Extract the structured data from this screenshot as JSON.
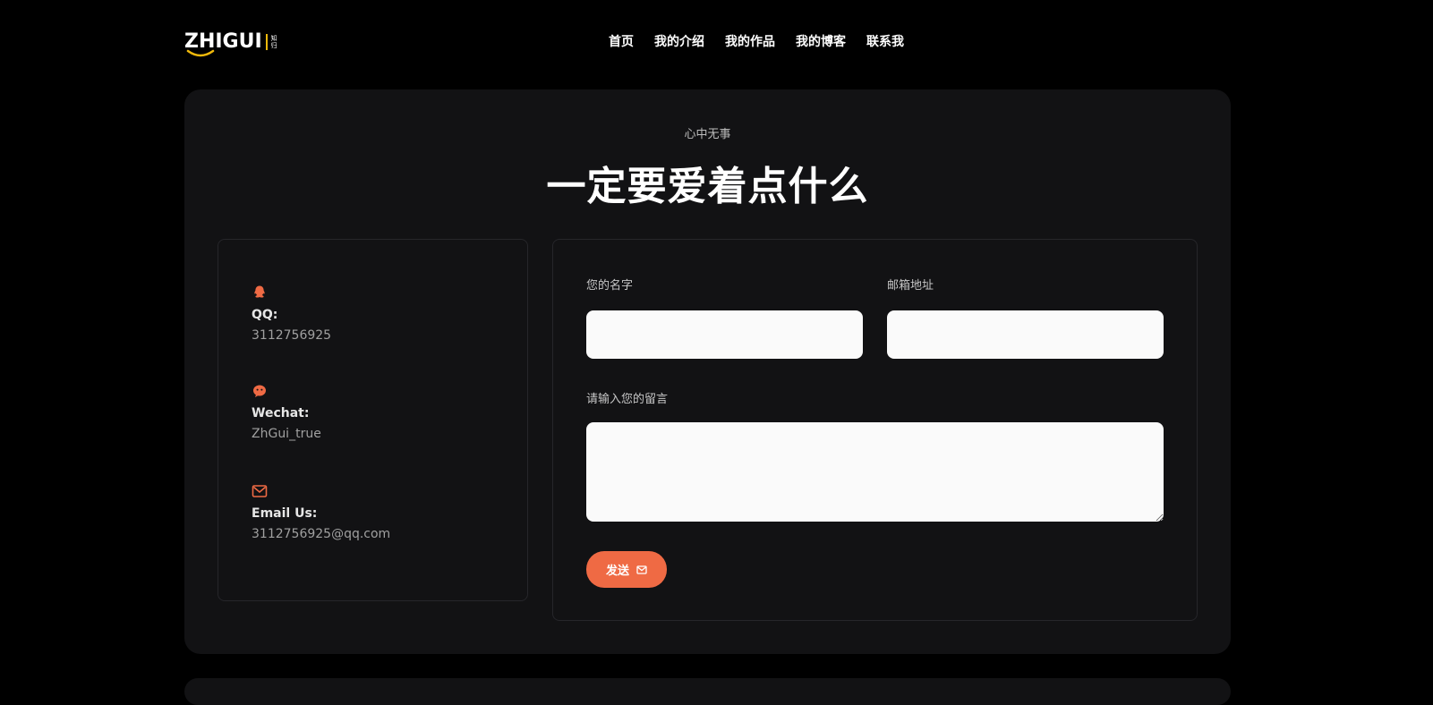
{
  "header": {
    "logo_text": "ZHIGUI",
    "logo_sub": "知归",
    "nav": [
      "首页",
      "我的介绍",
      "我的作品",
      "我的博客",
      "联系我"
    ]
  },
  "hero": {
    "kicker": "心中无事",
    "title": "一定要爱着点什么"
  },
  "contact": {
    "items": [
      {
        "icon": "qq-icon",
        "label": "QQ:",
        "value": "3112756925"
      },
      {
        "icon": "wechat-icon",
        "label": "Wechat:",
        "value": "ZhGui_true"
      },
      {
        "icon": "mail-icon",
        "label": "Email Us:",
        "value": "3112756925@qq.com"
      }
    ]
  },
  "form": {
    "name_label": "您的名字",
    "email_label": "邮箱地址",
    "message_label": "请输入您的留言",
    "name_value": "",
    "email_value": "",
    "message_value": "",
    "send_label": "发送"
  },
  "colors": {
    "accent": "#ef6a44",
    "logo_accent": "#f0b90b",
    "card_bg": "#121214",
    "page_bg": "#000000"
  }
}
